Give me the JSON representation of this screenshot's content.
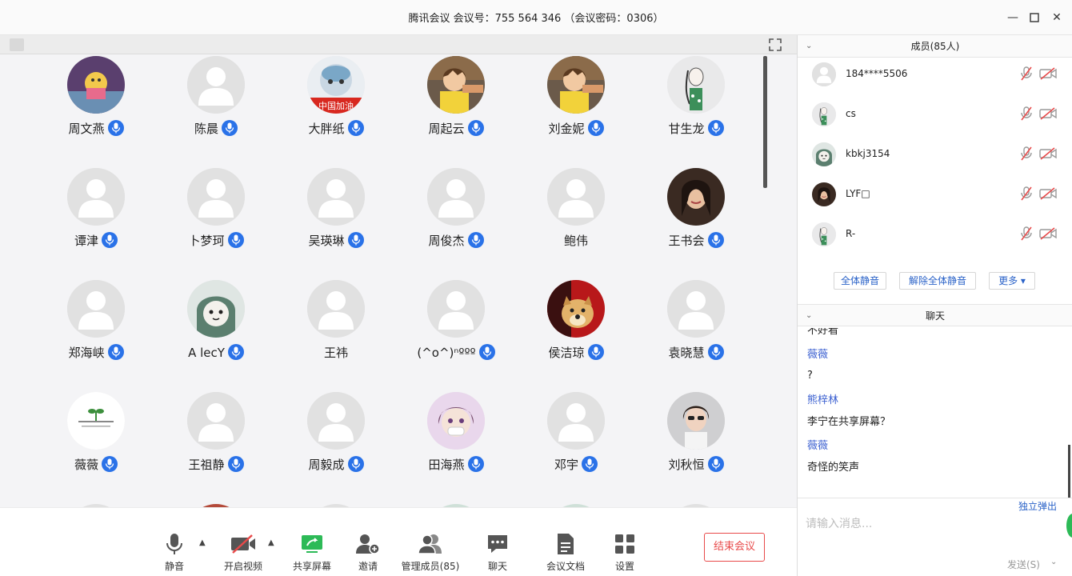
{
  "window": {
    "title": "腾讯会议 会议号：755 564 346 （会议密码：0306）",
    "minimize": "—",
    "maximize": "☐",
    "close": "✕"
  },
  "participants": [
    {
      "name": "周文燕",
      "mic": true,
      "avatar": "cartoon-cake-photo"
    },
    {
      "name": "陈晨",
      "mic": true,
      "avatar": "default"
    },
    {
      "name": "大胖纸",
      "mic": true,
      "avatar": "cartoon-cat-china"
    },
    {
      "name": "周起云",
      "mic": true,
      "avatar": "anime-boy"
    },
    {
      "name": "刘金妮",
      "mic": true,
      "avatar": "anime-boy"
    },
    {
      "name": "甘生龙",
      "mic": true,
      "avatar": "girl-sketch"
    },
    {
      "name": "谭津",
      "mic": true,
      "avatar": "default"
    },
    {
      "name": "卜梦珂",
      "mic": true,
      "avatar": "default"
    },
    {
      "name": "吴瑛琳",
      "mic": true,
      "avatar": "default"
    },
    {
      "name": "周俊杰",
      "mic": true,
      "avatar": "default"
    },
    {
      "name": "鲍伟",
      "mic": false,
      "avatar": "default"
    },
    {
      "name": "王书会",
      "mic": true,
      "avatar": "girl-photo"
    },
    {
      "name": "郑海峡",
      "mic": true,
      "avatar": "default"
    },
    {
      "name": "A lecY",
      "mic": true,
      "avatar": "cartoon-dino"
    },
    {
      "name": "王祎",
      "mic": false,
      "avatar": "default"
    },
    {
      "name": "(^o^)ⁿººº",
      "mic": true,
      "avatar": "default"
    },
    {
      "name": "侯洁琼",
      "mic": true,
      "avatar": "doge"
    },
    {
      "name": "袁晓慧",
      "mic": true,
      "avatar": "default"
    },
    {
      "name": "薇薇",
      "mic": true,
      "avatar": "plant-logo"
    },
    {
      "name": "王祖静",
      "mic": true,
      "avatar": "default"
    },
    {
      "name": "周毅成",
      "mic": true,
      "avatar": "default"
    },
    {
      "name": "田海燕",
      "mic": true,
      "avatar": "anime-girl"
    },
    {
      "name": "邓宇",
      "mic": true,
      "avatar": "default"
    },
    {
      "name": "刘秋恒",
      "mic": true,
      "avatar": "child-photo"
    }
  ],
  "toolbar": {
    "mute": "静音",
    "video": "开启视频",
    "share": "共享屏幕",
    "invite": "邀请",
    "manage": "管理成员(85)",
    "chat": "聊天",
    "docs": "会议文档",
    "settings": "设置",
    "end": "结束会议"
  },
  "members_panel": {
    "title": "成员(85人)",
    "members": [
      {
        "name": "184****5506"
      },
      {
        "name": "cs"
      },
      {
        "name": "kbkj3154"
      },
      {
        "name": "LYF□"
      },
      {
        "name": "R-"
      }
    ],
    "mute_all": "全体静音",
    "unmute_all": "解除全体静音",
    "more": "更多 ▾"
  },
  "chat_panel": {
    "title": "聊天",
    "partial_top": "不好看",
    "messages": [
      {
        "sender": "薇薇",
        "text": "?"
      },
      {
        "sender": "熊梓林",
        "text": "李宁在共享屏幕？"
      },
      {
        "sender": "薇薇",
        "text": "奇怪的笑声"
      }
    ],
    "popout": "独立弹出",
    "placeholder": "请输入消息...",
    "send": "发送(S)"
  },
  "colors": {
    "accent": "#2a72e8",
    "end": "#e84a4a",
    "share_green": "#2dba57"
  }
}
